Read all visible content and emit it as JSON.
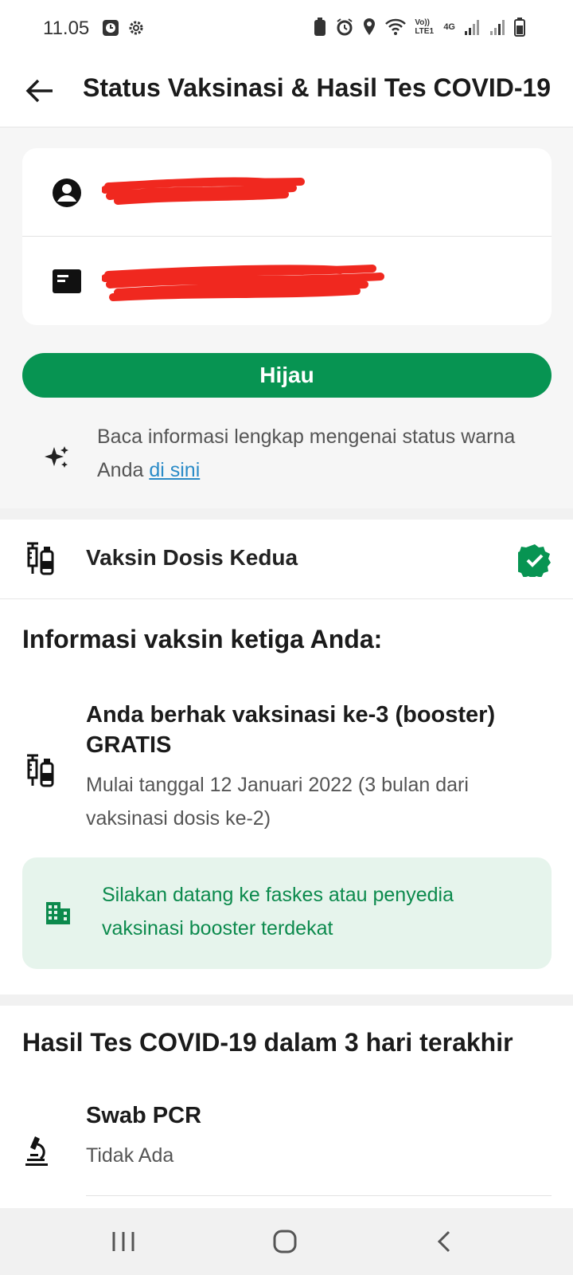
{
  "status_bar": {
    "time": "11.05",
    "network_label_1": "Vo)) LTE1",
    "network_label_2": "4G"
  },
  "app_bar": {
    "title": "Status Vaksinasi & Hasil Tes COVID-19"
  },
  "identity": {
    "name_icon": "account-circle-icon",
    "id_icon": "id-card-icon"
  },
  "status": {
    "label": "Hijau",
    "color": "#079452"
  },
  "info": {
    "text": "Baca informasi lengkap mengenai status warna Anda ",
    "link": "di sini"
  },
  "vaccine": {
    "label": "Vaksin Dosis Kedua",
    "verified_color": "#079452"
  },
  "booster": {
    "section_title": "Informasi vaksin ketiga Anda:",
    "headline": "Anda berhak vaksinasi ke-3 (booster) GRATIS",
    "sub": "Mulai tanggal 12 Januari 2022 (3 bulan dari vaksinasi dosis ke-2)",
    "notice": "Silakan datang ke faskes atau penyedia vaksinasi booster terdekat"
  },
  "tests": {
    "section_title": "Hasil Tes COVID-19 dalam 3 hari terakhir",
    "items": [
      {
        "name": "Swab PCR",
        "value": "Tidak Ada"
      }
    ]
  }
}
